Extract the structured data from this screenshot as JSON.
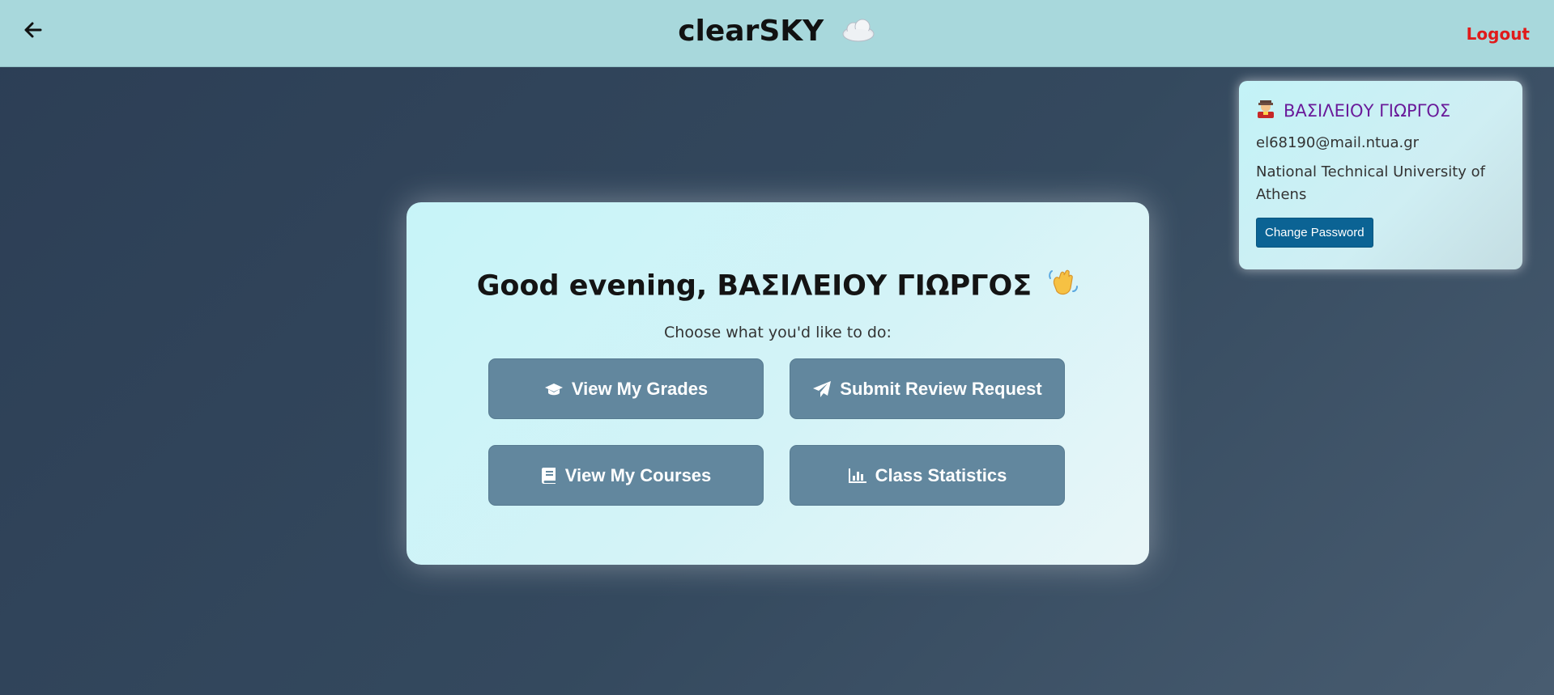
{
  "header": {
    "brand": "clearSKY",
    "logout_label": "Logout",
    "back_icon": "arrow-left-icon",
    "brand_icon": "cloud-icon"
  },
  "profile": {
    "name": "ΒΑΣΙΛΕΙΟΥ ΓΙΩΡΓΟΣ",
    "email": "el68190@mail.ntua.gr",
    "institution": "National Technical University of Athens",
    "change_password_label": "Change Password",
    "avatar_icon": "student-avatar-icon"
  },
  "main": {
    "greeting": "Good evening, ΒΑΣΙΛΕΙΟΥ ΓΙΩΡΓΟΣ",
    "prompt": "Choose what you'd like to do:",
    "actions": [
      {
        "label": "View My Grades",
        "icon": "graduation-cap-icon"
      },
      {
        "label": "Submit Review Request",
        "icon": "paper-plane-icon"
      },
      {
        "label": "View My Courses",
        "icon": "book-icon"
      },
      {
        "label": "Class Statistics",
        "icon": "bar-chart-icon"
      }
    ]
  },
  "colors": {
    "header_bg": "#a8d8dc",
    "logout": "#e01b1b",
    "profile_name": "#6a1b9a",
    "button": "#62879e",
    "change_password": "#0b6394"
  }
}
